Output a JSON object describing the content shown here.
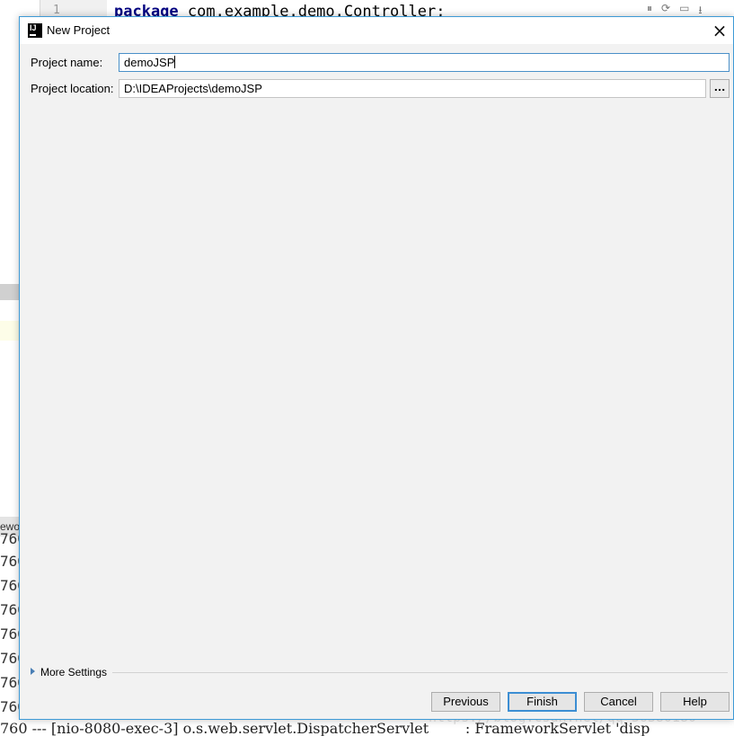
{
  "ide": {
    "line_number": "1",
    "code_keyword": "package",
    "code_rest": " com.example.demo.Controller;",
    "console_tab_label": "ewo",
    "console_line_prefix": "760",
    "log_line": "760 --- [nio-8080-exec-3] o.s.web.servlet.DispatcherServlet        : FrameworkServlet 'disp",
    "watermark": "https://blog.csdn.net/qq_36380180"
  },
  "dialog": {
    "title": "New Project",
    "close_icon": "×",
    "project_name_label": "Project name:",
    "project_name_value": "demoJSP",
    "project_location_label": "Project location:",
    "project_location_value": "D:\\IDEAProjects\\demoJSP",
    "browse_label": "...",
    "more_settings_label": "More Settings",
    "buttons": {
      "previous": "Previous",
      "finish": "Finish",
      "cancel": "Cancel",
      "help": "Help"
    }
  },
  "colors": {
    "dialog_border": "#3d9ad6",
    "dialog_bg": "#f2f2f2",
    "focus": "#4a90c8"
  }
}
